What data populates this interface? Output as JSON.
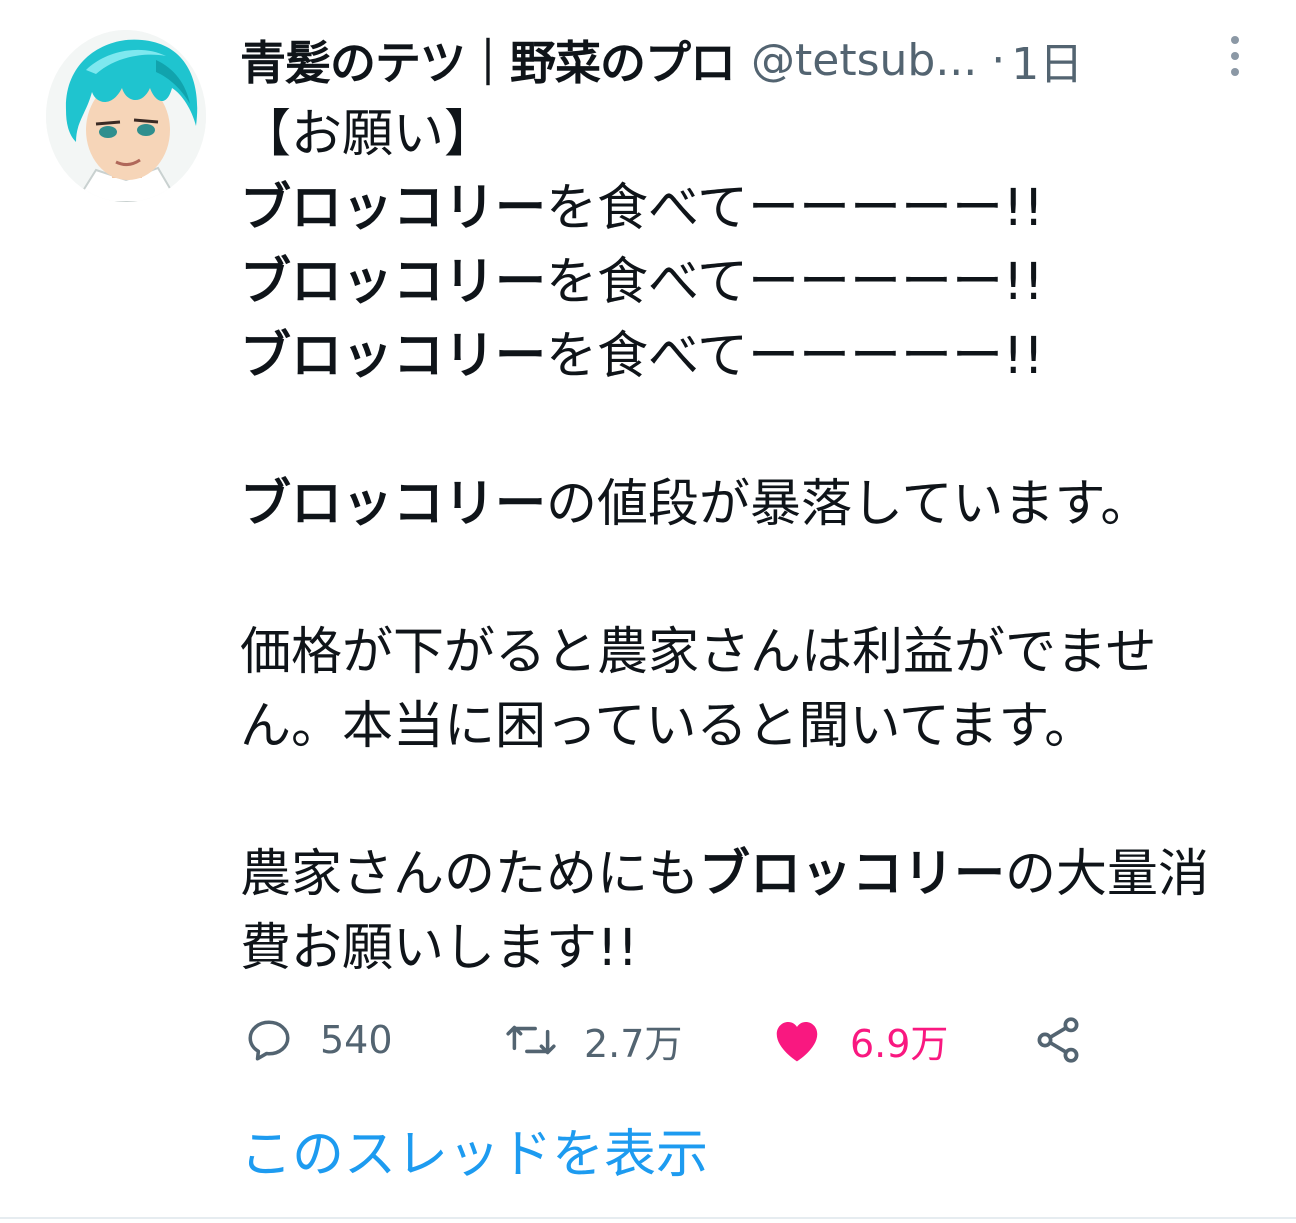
{
  "header": {
    "display_name": "青髪のテツ｜野菜のプロ",
    "handle": "@tetsub...",
    "separator": "·",
    "time": "1日"
  },
  "body": {
    "lines": [
      [
        {
          "t": "【お願い】",
          "b": false
        }
      ],
      [
        {
          "t": "ブロッコリー",
          "b": true
        },
        {
          "t": "を食べてーーーーー!!",
          "b": false
        }
      ],
      [
        {
          "t": "ブロッコリー",
          "b": true
        },
        {
          "t": "を食べてーーーーー!!",
          "b": false
        }
      ],
      [
        {
          "t": "ブロッコリー",
          "b": true
        },
        {
          "t": "を食べてーーーーー!!",
          "b": false
        }
      ],
      [],
      [
        {
          "t": "ブロッコリー",
          "b": true
        },
        {
          "t": "の値段が暴落しています。",
          "b": false
        }
      ],
      [],
      [
        {
          "t": "価格が下がると農家さんは利益がでませ",
          "b": false
        }
      ],
      [
        {
          "t": "ん。本当に困っていると聞いてます。",
          "b": false
        }
      ],
      [],
      [
        {
          "t": "農家さんのためにも",
          "b": false
        },
        {
          "t": "ブロッコリー",
          "b": true
        },
        {
          "t": "の大量消",
          "b": false
        }
      ],
      [
        {
          "t": "費お願いします!!",
          "b": false
        }
      ]
    ]
  },
  "actions": {
    "reply": {
      "icon": "reply-icon",
      "count": "540"
    },
    "retweet": {
      "icon": "retweet-icon",
      "count": "2.7万"
    },
    "like": {
      "icon": "heart-icon",
      "count": "6.9万",
      "color": "#f91880"
    },
    "share": {
      "icon": "share-icon"
    }
  },
  "thread_link": "このスレッドを表示",
  "colors": {
    "text": "#0f1419",
    "muted": "#536471",
    "link": "#1d9bf0",
    "like": "#f91880"
  }
}
